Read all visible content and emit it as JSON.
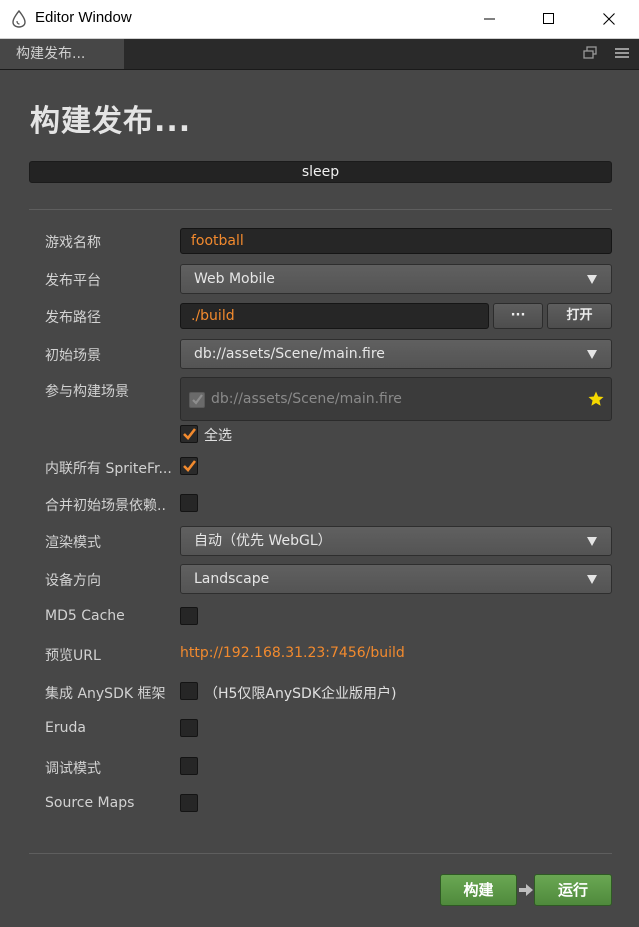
{
  "window": {
    "title": "Editor Window"
  },
  "tab": {
    "label": "构建发布..."
  },
  "page": {
    "title": "构建发布...",
    "progress_text": "sleep"
  },
  "fields": {
    "game_name": {
      "label": "游戏名称",
      "value": "football"
    },
    "platform": {
      "label": "发布平台",
      "value": "Web Mobile"
    },
    "path": {
      "label": "发布路径",
      "value": "./build",
      "browse_label": "···",
      "open_label": "打开"
    },
    "start_scene": {
      "label": "初始场景",
      "value": "db://assets/Scene/main.fire"
    },
    "build_scenes": {
      "label": "参与构建场景",
      "items": [
        "db://assets/Scene/main.fire"
      ],
      "select_all_label": "全选",
      "select_all_checked": true
    },
    "inline_sprite": {
      "label": "内联所有 SpriteFr...",
      "checked": true
    },
    "merge_deps": {
      "label": "合并初始场景依赖..",
      "checked": false
    },
    "render_mode": {
      "label": "渲染模式",
      "value": "自动（优先 WebGL）"
    },
    "orientation": {
      "label": "设备方向",
      "value": "Landscape"
    },
    "md5_cache": {
      "label": "MD5 Cache",
      "checked": false
    },
    "preview_url": {
      "label": "预览URL",
      "value": "http://192.168.31.23:7456/build"
    },
    "anysdk": {
      "label": "集成 AnySDK 框架",
      "checked": false,
      "note": "（H5仅限AnySDK企业版用户)"
    },
    "eruda": {
      "label": "Eruda",
      "checked": false
    },
    "debug_mode": {
      "label": "调试模式",
      "checked": false
    },
    "source_maps": {
      "label": "Source Maps",
      "checked": false
    }
  },
  "actions": {
    "build_label": "构建",
    "run_label": "运行"
  },
  "colors": {
    "accent": "#f28a2e",
    "button_green": "#5a9a45",
    "background": "#474747",
    "star": "#f5d800"
  }
}
